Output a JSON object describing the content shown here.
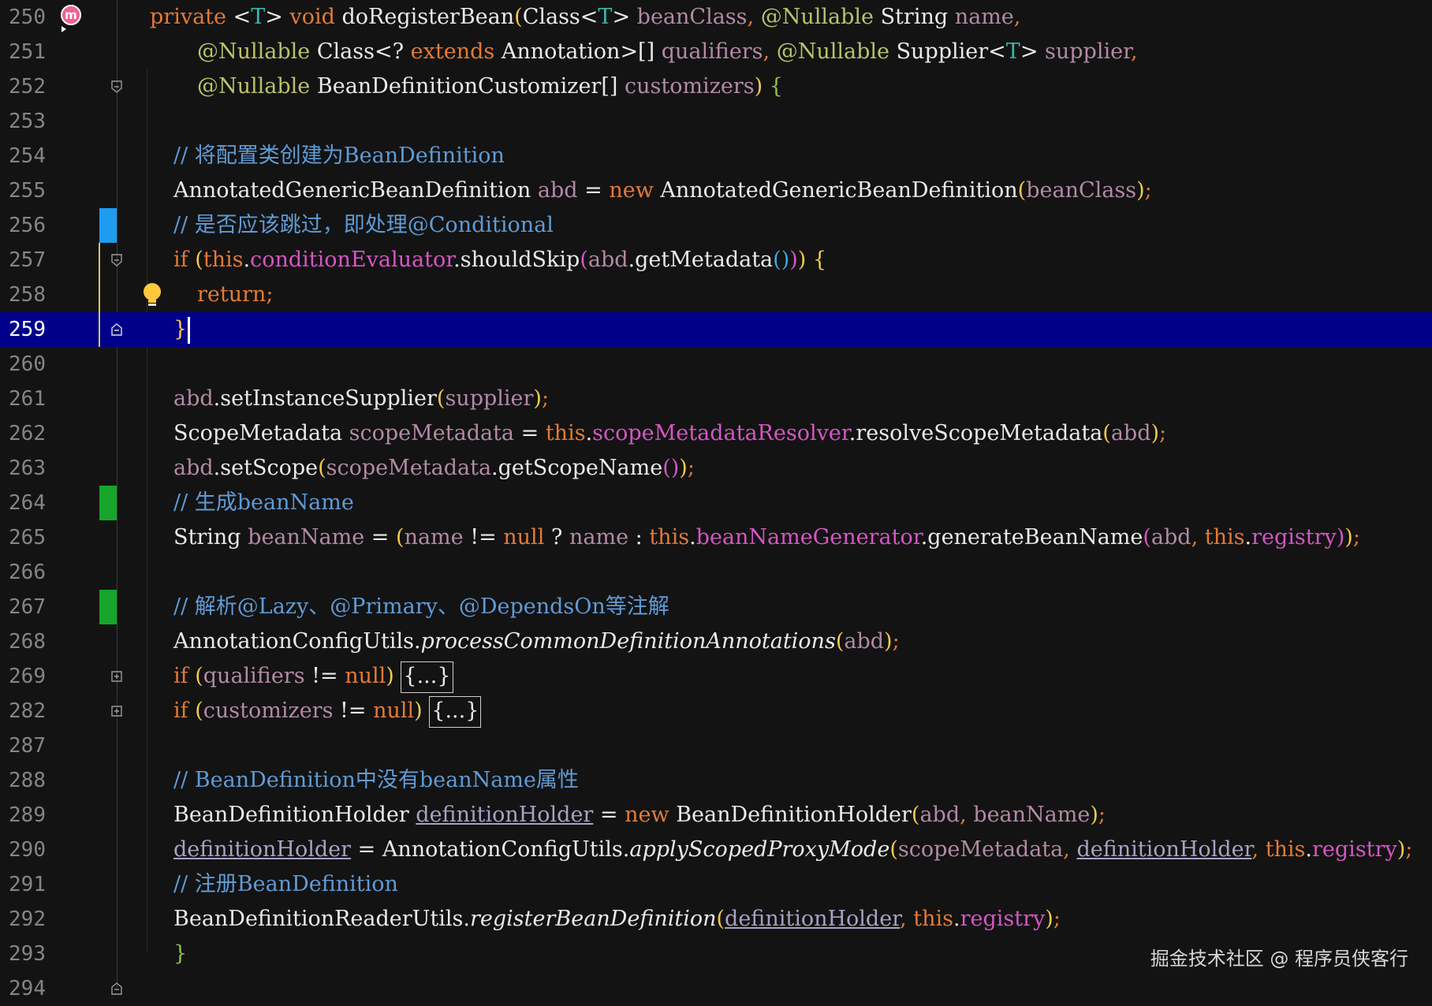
{
  "editor": {
    "current_line": "259",
    "lines": [
      {
        "num": "250",
        "segs": [
          [
            "kw",
            "private "
          ],
          [
            "pn",
            "<"
          ],
          [
            "tp",
            "T"
          ],
          [
            "pn",
            "> "
          ],
          [
            "kw",
            "void "
          ],
          [
            "fn",
            "doRegisterBean"
          ],
          [
            "br1",
            "("
          ],
          [
            "ty",
            "Class"
          ],
          [
            "pn",
            "<"
          ],
          [
            "tp",
            "T"
          ],
          [
            "pn",
            "> "
          ],
          [
            "pa",
            "beanClass"
          ],
          [
            "kw",
            ", "
          ],
          [
            "an",
            "@Nullable "
          ],
          [
            "ty",
            "String "
          ],
          [
            "pa",
            "name"
          ],
          [
            "kw",
            ","
          ]
        ]
      },
      {
        "num": "251",
        "segs": [
          [
            "an",
            "@Nullable "
          ],
          [
            "ty",
            "Class"
          ],
          [
            "pn",
            "<? "
          ],
          [
            "kw",
            "extends "
          ],
          [
            "ty",
            "Annotation"
          ],
          [
            "pn",
            ">[] "
          ],
          [
            "pa",
            "qualifiers"
          ],
          [
            "kw",
            ", "
          ],
          [
            "an",
            "@Nullable "
          ],
          [
            "ty",
            "Supplier"
          ],
          [
            "pn",
            "<"
          ],
          [
            "tp",
            "T"
          ],
          [
            "pn",
            "> "
          ],
          [
            "pa",
            "supplier"
          ],
          [
            "kw",
            ","
          ]
        ]
      },
      {
        "num": "252",
        "segs": [
          [
            "an",
            "@Nullable "
          ],
          [
            "ty",
            "BeanDefinitionCustomizer"
          ],
          [
            "pn",
            "[] "
          ],
          [
            "pa",
            "customizers"
          ],
          [
            "br1",
            ") "
          ],
          [
            "br4",
            "{"
          ]
        ]
      },
      {
        "num": "253",
        "segs": []
      },
      {
        "num": "254",
        "segs": [
          [
            "cm",
            "// 将配置类创建为BeanDefinition"
          ]
        ]
      },
      {
        "num": "255",
        "segs": [
          [
            "ty",
            "AnnotatedGenericBeanDefinition "
          ],
          [
            "lv",
            "abd"
          ],
          [
            "pn",
            " = "
          ],
          [
            "kw",
            "new "
          ],
          [
            "ty",
            "AnnotatedGenericBeanDefinition"
          ],
          [
            "br1",
            "("
          ],
          [
            "pa",
            "beanClass"
          ],
          [
            "br1",
            ")"
          ],
          [
            "kw",
            ";"
          ]
        ]
      },
      {
        "num": "256",
        "segs": [
          [
            "cm",
            "// 是否应该跳过，即处理@Conditional"
          ]
        ]
      },
      {
        "num": "257",
        "segs": [
          [
            "kw",
            "if "
          ],
          [
            "br1",
            "("
          ],
          [
            "kw",
            "this"
          ],
          [
            "pn",
            "."
          ],
          [
            "fd",
            "conditionEvaluator"
          ],
          [
            "pn",
            "."
          ],
          [
            "fn",
            "shouldSkip"
          ],
          [
            "br2",
            "("
          ],
          [
            "lv",
            "abd"
          ],
          [
            "pn",
            "."
          ],
          [
            "fn",
            "getMetadata"
          ],
          [
            "br3",
            "()"
          ],
          [
            "br2",
            ")"
          ],
          [
            "br1",
            ")"
          ],
          [
            "pn",
            " "
          ],
          [
            "br1",
            "{"
          ]
        ]
      },
      {
        "num": "258",
        "segs": [
          [
            "kw",
            "return;"
          ]
        ]
      },
      {
        "num": "259",
        "segs": [
          [
            "br1",
            "}"
          ]
        ]
      },
      {
        "num": "260",
        "segs": []
      },
      {
        "num": "261",
        "segs": [
          [
            "lv",
            "abd"
          ],
          [
            "pn",
            "."
          ],
          [
            "fn",
            "setInstanceSupplier"
          ],
          [
            "br1",
            "("
          ],
          [
            "pa",
            "supplier"
          ],
          [
            "br1",
            ")"
          ],
          [
            "kw",
            ";"
          ]
        ]
      },
      {
        "num": "262",
        "segs": [
          [
            "ty",
            "ScopeMetadata "
          ],
          [
            "lv",
            "scopeMetadata"
          ],
          [
            "pn",
            " = "
          ],
          [
            "kw",
            "this"
          ],
          [
            "pn",
            "."
          ],
          [
            "fd",
            "scopeMetadataResolver"
          ],
          [
            "pn",
            "."
          ],
          [
            "fn",
            "resolveScopeMetadata"
          ],
          [
            "br1",
            "("
          ],
          [
            "lv",
            "abd"
          ],
          [
            "br1",
            ")"
          ],
          [
            "kw",
            ";"
          ]
        ]
      },
      {
        "num": "263",
        "segs": [
          [
            "lv",
            "abd"
          ],
          [
            "pn",
            "."
          ],
          [
            "fn",
            "setScope"
          ],
          [
            "br1",
            "("
          ],
          [
            "lv",
            "scopeMetadata"
          ],
          [
            "pn",
            "."
          ],
          [
            "fn",
            "getScopeName"
          ],
          [
            "br2",
            "()"
          ],
          [
            "br1",
            ")"
          ],
          [
            "kw",
            ";"
          ]
        ]
      },
      {
        "num": "264",
        "segs": [
          [
            "cm",
            "// 生成beanName"
          ]
        ]
      },
      {
        "num": "265",
        "segs": [
          [
            "ty",
            "String "
          ],
          [
            "lv",
            "beanName"
          ],
          [
            "pn",
            " = "
          ],
          [
            "br1",
            "("
          ],
          [
            "pa",
            "name"
          ],
          [
            "pn",
            " != "
          ],
          [
            "kw",
            "null"
          ],
          [
            "pn",
            " ? "
          ],
          [
            "pa",
            "name"
          ],
          [
            "pn",
            " : "
          ],
          [
            "kw",
            "this"
          ],
          [
            "pn",
            "."
          ],
          [
            "fd",
            "beanNameGenerator"
          ],
          [
            "pn",
            "."
          ],
          [
            "fn",
            "generateBeanName"
          ],
          [
            "br2",
            "("
          ],
          [
            "lv",
            "abd"
          ],
          [
            "kw",
            ", "
          ],
          [
            "kw",
            "this"
          ],
          [
            "pn",
            "."
          ],
          [
            "fd",
            "registry"
          ],
          [
            "br2",
            ")"
          ],
          [
            "br1",
            ")"
          ],
          [
            "kw",
            ";"
          ]
        ]
      },
      {
        "num": "266",
        "segs": []
      },
      {
        "num": "267",
        "segs": [
          [
            "cm",
            "// 解析@Lazy、@Primary、@DependsOn等注解"
          ]
        ]
      },
      {
        "num": "268",
        "segs": [
          [
            "ty",
            "AnnotationConfigUtils"
          ],
          [
            "pn",
            "."
          ],
          [
            "it",
            "processCommonDefinitionAnnotations"
          ],
          [
            "br1",
            "("
          ],
          [
            "lv",
            "abd"
          ],
          [
            "br1",
            ")"
          ],
          [
            "kw",
            ";"
          ]
        ]
      },
      {
        "num": "269",
        "segs": [
          [
            "kw",
            "if "
          ],
          [
            "br1",
            "("
          ],
          [
            "pa",
            "qualifiers"
          ],
          [
            "pn",
            " != "
          ],
          [
            "kw",
            "null"
          ],
          [
            "br1",
            ")"
          ],
          [
            "pn",
            " "
          ],
          [
            "fold",
            "{...}"
          ]
        ]
      },
      {
        "num": "282",
        "segs": [
          [
            "kw",
            "if "
          ],
          [
            "br1",
            "("
          ],
          [
            "pa",
            "customizers"
          ],
          [
            "pn",
            " != "
          ],
          [
            "kw",
            "null"
          ],
          [
            "br1",
            ")"
          ],
          [
            "pn",
            " "
          ],
          [
            "fold",
            "{...}"
          ]
        ]
      },
      {
        "num": "287",
        "segs": []
      },
      {
        "num": "288",
        "segs": [
          [
            "cm",
            "// BeanDefinition中没有beanName属性"
          ]
        ]
      },
      {
        "num": "289",
        "segs": [
          [
            "ty",
            "BeanDefinitionHolder "
          ],
          [
            "dh",
            "definitionHolder"
          ],
          [
            "pn",
            " = "
          ],
          [
            "kw",
            "new "
          ],
          [
            "ty",
            "BeanDefinitionHolder"
          ],
          [
            "br1",
            "("
          ],
          [
            "lv",
            "abd"
          ],
          [
            "kw",
            ", "
          ],
          [
            "lv",
            "beanName"
          ],
          [
            "br1",
            ")"
          ],
          [
            "kw",
            ";"
          ]
        ]
      },
      {
        "num": "290",
        "segs": [
          [
            "dh",
            "definitionHolder"
          ],
          [
            "pn",
            " = "
          ],
          [
            "ty",
            "AnnotationConfigUtils"
          ],
          [
            "pn",
            "."
          ],
          [
            "it",
            "applyScopedProxyMode"
          ],
          [
            "br1",
            "("
          ],
          [
            "lv",
            "scopeMetadata"
          ],
          [
            "kw",
            ", "
          ],
          [
            "dh",
            "definitionHolder"
          ],
          [
            "kw",
            ", "
          ],
          [
            "kw",
            "this"
          ],
          [
            "pn",
            "."
          ],
          [
            "fd",
            "registry"
          ],
          [
            "br1",
            ")"
          ],
          [
            "kw",
            ";"
          ]
        ]
      },
      {
        "num": "291",
        "segs": [
          [
            "cm",
            "// 注册BeanDefinition"
          ]
        ]
      },
      {
        "num": "292",
        "segs": [
          [
            "ty",
            "BeanDefinitionReaderUtils"
          ],
          [
            "pn",
            "."
          ],
          [
            "it",
            "registerBeanDefinition"
          ],
          [
            "br1",
            "("
          ],
          [
            "dh",
            "definitionHolder"
          ],
          [
            "kw",
            ", "
          ],
          [
            "kw",
            "this"
          ],
          [
            "pn",
            "."
          ],
          [
            "fd",
            "registry"
          ],
          [
            "br1",
            ")"
          ],
          [
            "kw",
            ";"
          ]
        ]
      },
      {
        "num": "293",
        "segs": [
          [
            "br4",
            "}"
          ]
        ]
      },
      {
        "num": "294",
        "segs": []
      }
    ]
  },
  "watermark": "掘金技术社区 @ 程序员侠客行",
  "colors": {
    "background": "#131313",
    "current_line": "#00008b",
    "keyword": "#e37a36",
    "comment": "#5f9bd6",
    "field": "#d556c4",
    "annotation": "#b9c26a",
    "change_added": "#17a52b",
    "change_modified": "#1e9cf0"
  }
}
